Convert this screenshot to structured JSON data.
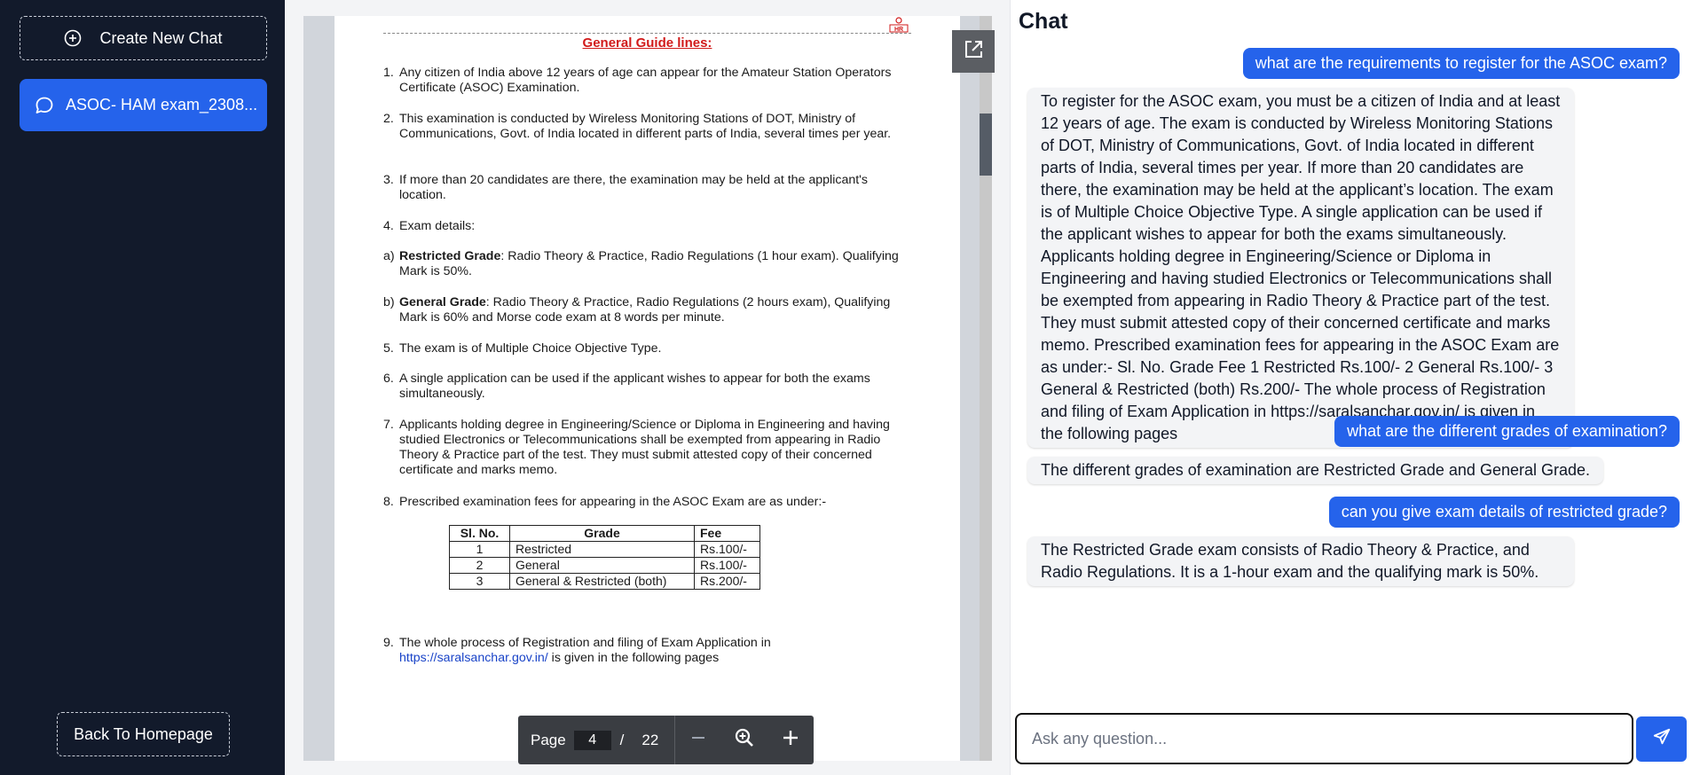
{
  "sidebar": {
    "create_label": "Create New Chat",
    "chat_items": [
      {
        "label": "ASOC- HAM exam_2308..."
      }
    ],
    "back_label": "Back To Homepage"
  },
  "pdf": {
    "title": "General Guide lines:",
    "items": [
      {
        "num": "1.",
        "text": "Any citizen of India above 12 years of age can appear for the Amateur Station Operators Certificate (ASOC) Examination."
      },
      {
        "num": "2.",
        "text": "This examination is conducted by Wireless Monitoring Stations of DOT, Ministry of Communications, Govt. of India located in different parts of India, several times per year."
      },
      {
        "num": "3.",
        "text": "If more than 20 candidates are there, the examination may be held at the applicant's location."
      },
      {
        "num": "4.",
        "text": "Exam details:"
      },
      {
        "num": "a)",
        "bold": "Restricted Grade",
        "text": ": Radio Theory & Practice, Radio Regulations (1 hour exam). Qualifying Mark is 50%."
      },
      {
        "num": "b)",
        "bold": "General Grade",
        "text": ": Radio Theory & Practice, Radio Regulations (2 hours exam), Qualifying Mark is 60% and Morse code exam at 8 words per minute."
      },
      {
        "num": "5.",
        "text": "The exam is of Multiple Choice Objective Type."
      },
      {
        "num": "6.",
        "text": "A single application can be used if the applicant wishes to appear for both the exams simultaneously."
      },
      {
        "num": "7.",
        "text": "Applicants holding degree in Engineering/Science or Diploma in Engineering and having studied Electronics or Telecommunications shall be exempted from appearing in Radio Theory & Practice part of the test. They must submit attested copy of their concerned certificate and marks memo."
      },
      {
        "num": "8.",
        "text": "Prescribed examination fees for appearing in the ASOC Exam are as under:-"
      },
      {
        "num": "9.",
        "text": "The whole process of Registration and filing of Exam Application in",
        "link": "https://saralsanchar.gov.in/",
        "after": " is given in the following pages"
      }
    ],
    "table": {
      "headers": [
        "Sl. No.",
        "Grade",
        "Fee"
      ],
      "rows": [
        [
          "1",
          "Restricted",
          "Rs.100/-"
        ],
        [
          "2",
          "General",
          "Rs.100/-"
        ],
        [
          "3",
          "General & Restricted (both)",
          "Rs.200/-"
        ]
      ]
    },
    "pager": {
      "page_label": "Page",
      "current": "4",
      "slash": "/",
      "total": "22"
    }
  },
  "chat": {
    "title": "Chat",
    "messages": [
      {
        "role": "user",
        "text": "what are the requirements to register for the ASOC exam?"
      },
      {
        "role": "bot",
        "text": "To register for the ASOC exam, you must be a citizen of India and at least 12 years of age. The exam is conducted by Wireless Monitoring Stations of DOT, Ministry of Communications, Govt. of India located in different parts of India, several times per year. If more than 20 candidates are there, the examination may be held at the applicant’s location. The exam is of Multiple Choice Objective Type. A single application can be used if the applicant wishes to appear for both the exams simultaneously. Applicants holding degree in Engineering/Science or Diploma in Engineering and having studied Electronics or Telecommunications shall be exempted from appearing in Radio Theory & Practice part of the test. They must submit attested copy of their concerned certificate and marks memo. Prescribed examination fees for appearing in the ASOC Exam are as under:- Sl. No. Grade Fee 1 Restricted Rs.100/- 2 General Rs.100/- 3 General & Restricted (both) Rs.200/- The whole process of Registration and filing of Exam Application in https://saralsanchar.gov.in/ is given in the following pages"
      },
      {
        "role": "user",
        "text": "what are the different grades of examination?"
      },
      {
        "role": "bot",
        "text": "The different grades of examination are Restricted Grade and General Grade."
      },
      {
        "role": "user",
        "text": "can you give exam details of restricted grade?"
      },
      {
        "role": "bot",
        "text": "The Restricted Grade exam consists of Radio Theory & Practice, and Radio Regulations. It is a 1-hour exam and the qualifying mark is 50%."
      }
    ],
    "input_placeholder": "Ask any question..."
  },
  "colors": {
    "sidebar_bg": "#121a2b",
    "accent": "#2563eb",
    "bot_bubble": "#f3f4f6",
    "pdf_title": "#d11a1a"
  }
}
